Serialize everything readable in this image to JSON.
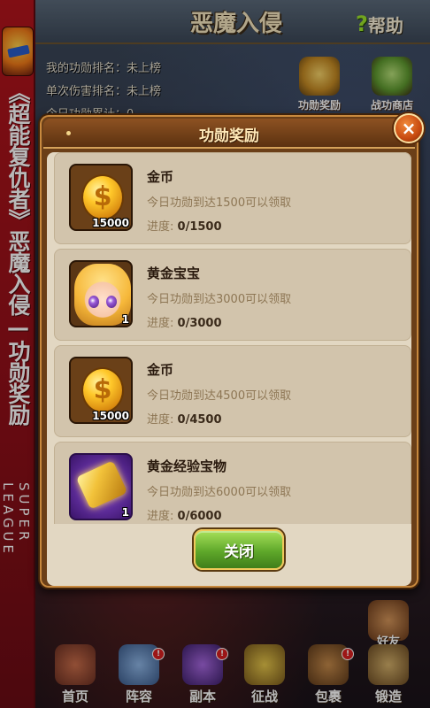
{
  "side_banner": {
    "title": "《超能复仇者》恶魔入侵—功勋奖励",
    "brand_lines": [
      "SUPER",
      "LEAGUE"
    ]
  },
  "header": {
    "title": "恶魔入侵",
    "help_icon": "?",
    "help_label": "帮助"
  },
  "ranking": {
    "my_merit_rank": "我的功勋排名：未上榜",
    "single_damage_rank": "单次伤害排名：未上榜",
    "today_merit_total": "今日功勋累计：0"
  },
  "shortcuts": {
    "merit_reward": "功勋奖励",
    "merit_shop": "战功商店"
  },
  "dialog": {
    "title": "功勋奖励",
    "close_icon": "×",
    "close_button": "关闭",
    "progress_label": "进度:",
    "rewards": [
      {
        "name": "金币",
        "condition": "今日功勋到达1500可以领取",
        "progress": "0/1500",
        "qty": "15000",
        "icon": "gold-coin-icon"
      },
      {
        "name": "黄金宝宝",
        "condition": "今日功勋到达3000可以领取",
        "progress": "0/3000",
        "qty": "1",
        "icon": "golden-baby-icon"
      },
      {
        "name": "金币",
        "condition": "今日功勋到达4500可以领取",
        "progress": "0/4500",
        "qty": "15000",
        "icon": "gold-coin-icon"
      },
      {
        "name": "黄金经验宝物",
        "condition": "今日功勋到达6000可以领取",
        "progress": "0/6000",
        "qty": "1",
        "icon": "golden-exp-treasure-icon"
      }
    ]
  },
  "bottom_nav": {
    "home": "首页",
    "lineup": "阵容",
    "dungeon": "副本",
    "battle": "征战",
    "bag": "包裹",
    "forge": "锻造",
    "friends": "好友",
    "badge": "!"
  },
  "colors": {
    "banner_red": "#b3141c",
    "dialog_brown": "#6b3f18",
    "panel_beige": "#e2d7c2",
    "row_beige": "#d2c4ac",
    "close_green": "#5fa82a",
    "close_x_orange": "#c84a10"
  }
}
